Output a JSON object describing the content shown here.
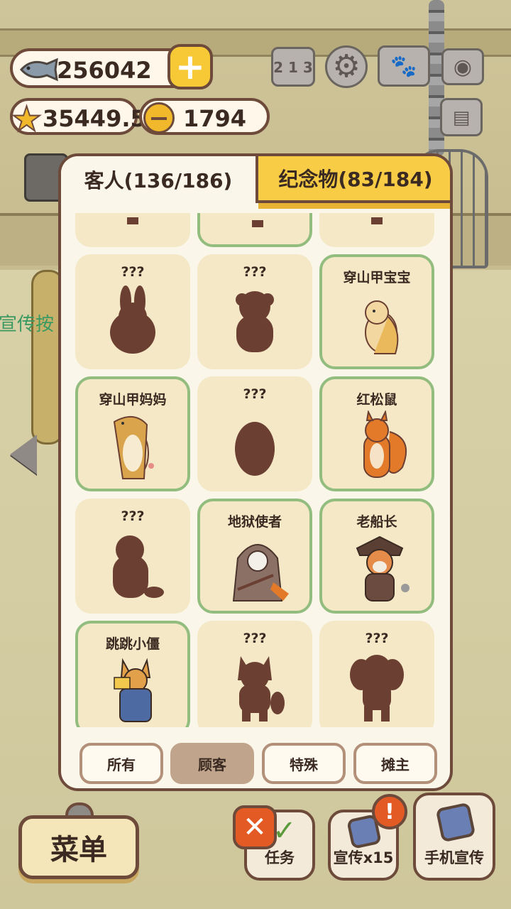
{
  "currency": {
    "fish": "256042",
    "stars": "35449.5",
    "bells": "1794",
    "plus": "+"
  },
  "background": {
    "partial_text": "宣传按"
  },
  "tabs": {
    "guests": "客人(136/186)",
    "souvenirs": "纪念物(83/184)"
  },
  "cards": [
    {
      "name": "",
      "known": false,
      "silhouette": "partial"
    },
    {
      "name": "",
      "known": true,
      "silhouette": "partial"
    },
    {
      "name": "",
      "known": false,
      "silhouette": "partial"
    },
    {
      "name": "???",
      "known": false,
      "silhouette": "rabbit"
    },
    {
      "name": "???",
      "known": false,
      "silhouette": "bear"
    },
    {
      "name": "穿山甲宝宝",
      "known": true,
      "silhouette": "baby-pangolin"
    },
    {
      "name": "穿山甲妈妈",
      "known": true,
      "silhouette": "mother-pangolin"
    },
    {
      "name": "???",
      "known": false,
      "silhouette": "hedgehog"
    },
    {
      "name": "红松鼠",
      "known": true,
      "silhouette": "red-squirrel"
    },
    {
      "name": "???",
      "known": false,
      "silhouette": "beaver"
    },
    {
      "name": "地狱使者",
      "known": true,
      "silhouette": "hell-messenger"
    },
    {
      "name": "老船长",
      "known": true,
      "silhouette": "old-captain"
    },
    {
      "name": "跳跳小僵",
      "known": true,
      "silhouette": "jiangshi-corgi"
    },
    {
      "name": "???",
      "known": false,
      "silhouette": "raccoon"
    },
    {
      "name": "???",
      "known": false,
      "silhouette": "poodle"
    }
  ],
  "filters": [
    {
      "label": "所有",
      "active": false
    },
    {
      "label": "顾客",
      "active": true
    },
    {
      "label": "特殊",
      "active": false
    },
    {
      "label": "摊主",
      "active": false
    }
  ],
  "bottom": {
    "menu": "菜单",
    "tasks": "任务",
    "promo": "宣传x15",
    "phone_promo": "手机宣传",
    "close": "✕",
    "alert": "!"
  },
  "icons": {
    "rank": "2 1 3",
    "gear": "⚙",
    "book": "🐾",
    "camera": "◉",
    "card": "▤"
  },
  "colors": {
    "panel_border": "#6e4a3a",
    "card_bg": "#f4e8c6",
    "known_border": "#93bd7f",
    "silhouette": "#6b3f32",
    "tab_active": "#f8cc45"
  }
}
